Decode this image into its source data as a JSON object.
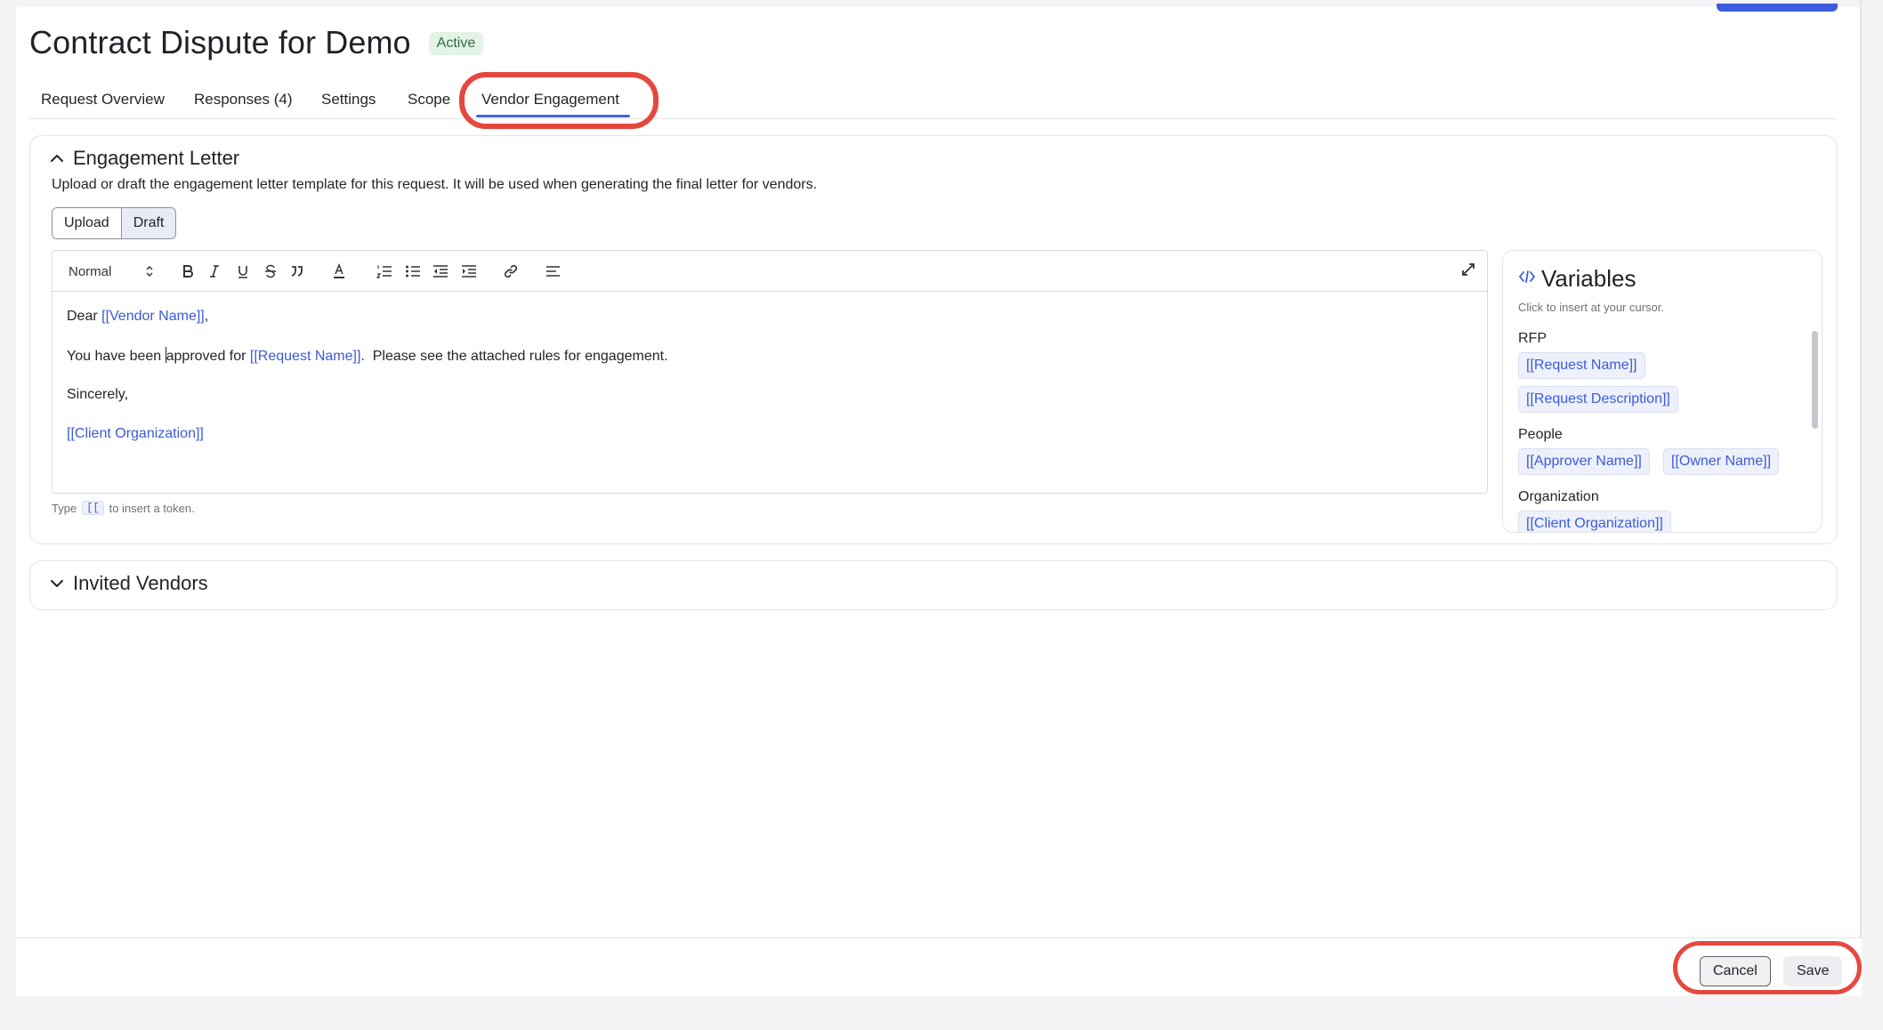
{
  "header": {
    "title": "Contract Dispute for Demo",
    "status": "Active"
  },
  "tabs": [
    {
      "label": "Request Overview"
    },
    {
      "label": "Responses (4)"
    },
    {
      "label": "Settings"
    },
    {
      "label": "Scope"
    },
    {
      "label": "Vendor Engagement",
      "active": true
    }
  ],
  "engagement": {
    "title": "Engagement Letter",
    "description": "Upload or draft the engagement letter template for this request. It will be used when generating the final letter for vendors.",
    "mode_options": [
      "Upload",
      "Draft"
    ],
    "selected_mode": "Draft",
    "toolbar": {
      "format_value": "Normal"
    },
    "letter": {
      "line1_text": "Dear ",
      "line1_token": "[[Vendor Name]]",
      "line1_end": ",",
      "line2_text_a": "You have been ",
      "line2_text_b": "approved for ",
      "line2_token": "[[Request Name]]",
      "line2_end": ".  Please see the attached rules for engagement.",
      "line3_text": "Sincerely,",
      "line4_token": "[[Client Organization]]"
    },
    "hint": {
      "prefix": "Type",
      "code": "[[",
      "suffix": "to insert a token."
    }
  },
  "variables": {
    "title": "Variables",
    "subtitle": "Click to insert at your cursor.",
    "groups": [
      {
        "label": "RFP",
        "tokens": [
          "[[Request Name]]",
          "[[Request Description]]"
        ]
      },
      {
        "label": "People",
        "tokens": [
          "[[Approver Name]]",
          "[[Owner Name]]"
        ]
      },
      {
        "label": "Organization",
        "tokens": [
          "[[Client Organization]]"
        ]
      }
    ]
  },
  "vendors": {
    "title": "Invited Vendors"
  },
  "footer": {
    "cancel_label": "Cancel",
    "save_label": "Save"
  },
  "colors": {
    "accent": "#4263eb",
    "token": "#3b5bdb",
    "highlight": "#e5483f",
    "status_bg": "#e3f3e6"
  }
}
